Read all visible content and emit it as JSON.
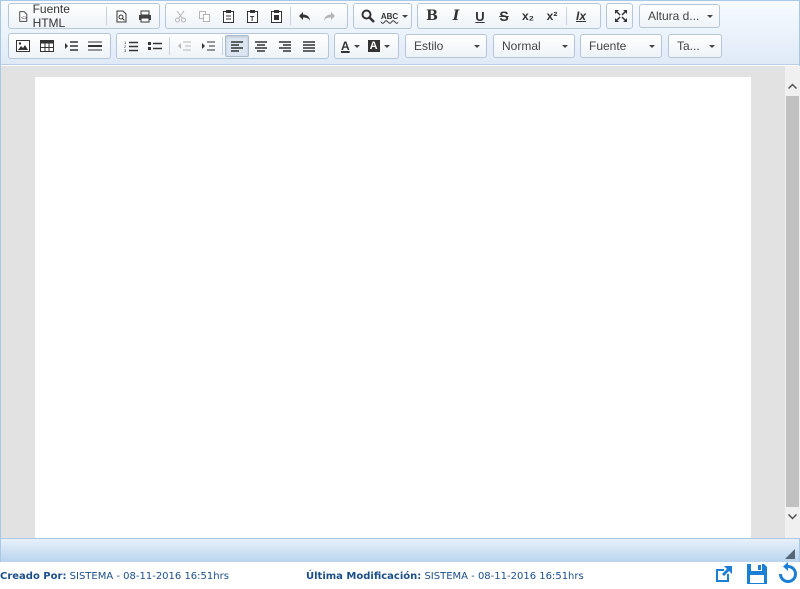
{
  "toolbar": {
    "source_label": "Fuente HTML",
    "line_height_label": "Altura d...",
    "style_label": "Estilo",
    "format_label": "Normal",
    "font_label": "Fuente",
    "size_label": "Ta...",
    "bold_label": "B",
    "italic_label": "I",
    "underline_label": "U",
    "strike_label": "S",
    "subscript_label": "x₂",
    "superscript_label": "x²",
    "remove_format_label": "Ix",
    "text_color_label": "A",
    "bg_color_label": "A",
    "spellcheck_label": "ABC"
  },
  "footer": {
    "created_label": "Creado Por:",
    "created_value": "SISTEMA - 08-11-2016 16:51hrs",
    "modified_label": "Última Modificación:",
    "modified_value": "SISTEMA - 08-11-2016 16:51hrs"
  },
  "colors": {
    "accent": "#1b7fd6",
    "toolbar_bg": "#dfeaf7",
    "canvas_bg": "#e2e2e2"
  }
}
